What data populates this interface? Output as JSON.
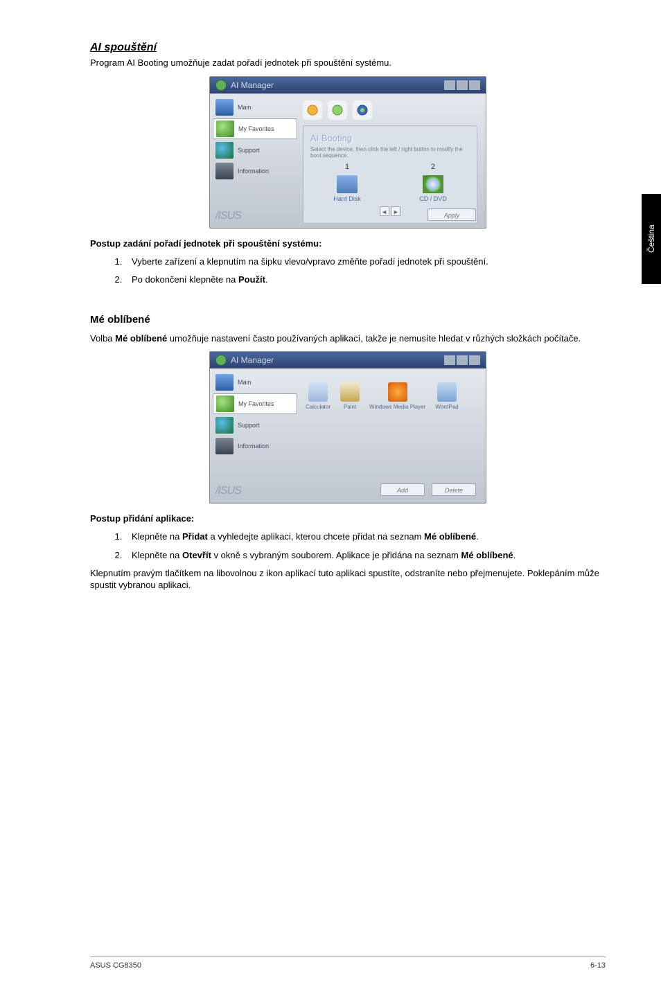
{
  "heading_ai": "AI spouštění",
  "intro_ai": "Program AI Booting umožňuje zadat pořadí jednotek při spouštění systému.",
  "sub_proc_boot": "Postup zadání pořadí jednotek při spouštění systému:",
  "boot_steps": [
    "Vyberte zařízení a klepnutím na šipku vlevo/vpravo změňte pořadí jednotek při spouštění.",
    "Po dokončení klepněte na "
  ],
  "boot_step2_strong": "Použít",
  "boot_step2_suffix": ".",
  "heading_fav": "Mé oblíbené",
  "fav_intro_pre": "Volba ",
  "fav_intro_strong": "Mé oblíbené",
  "fav_intro_post": " umožňuje nastavení často používaných aplikací, takže je nemusíte hledat v růzhých složkách počítače.",
  "sub_proc_add": "Postup přidání aplikace:",
  "add_steps": {
    "s1_pre": "Klepněte na ",
    "s1_b1": "Přidat",
    "s1_mid": " a vyhledejte aplikaci, kterou chcete přidat na seznam ",
    "s1_b2": "Mé oblíbené",
    "s1_suf": ".",
    "s2_pre": "Klepněte na ",
    "s2_b1": "Otevřít",
    "s2_mid": " v okně s vybraným souborem. Aplikace je přidána na seznam ",
    "s2_b2": "Mé oblíbené",
    "s2_suf": "."
  },
  "outro": "Klepnutím pravým tlačítkem na libovolnou z ikon aplikací tuto aplikaci spustíte, odstraníte nebo přejmenujete. Poklepáním může spustit vybranou aplikaci.",
  "sidetab": "Čeština",
  "footer_left": "ASUS CG8350",
  "footer_right": "6-13",
  "win": {
    "title": "AI Manager",
    "sb": [
      "Main",
      "My Favorites",
      "Support",
      "Information"
    ],
    "brand": "/ISUS",
    "boot": {
      "panel_title": "AI Booting",
      "panel_desc": "Select the device, then click the left / right button to modify the boot sequence.",
      "cols": [
        {
          "num": "1",
          "label": "Hard Disk"
        },
        {
          "num": "2",
          "label": "CD / DVD"
        }
      ],
      "apply": "Apply"
    },
    "fav": {
      "items": [
        {
          "label": "Calculator"
        },
        {
          "label": "Paint"
        },
        {
          "label": "Windows Media Player"
        },
        {
          "label": "WordPad"
        }
      ],
      "add": "Add",
      "del": "Delete"
    }
  }
}
